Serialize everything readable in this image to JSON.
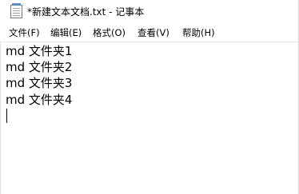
{
  "window": {
    "title": "*新建文本文档.txt - 记事本",
    "app_icon": "notepad-icon"
  },
  "menubar": {
    "file": "文件(F)",
    "edit": "编辑(E)",
    "format": "格式(O)",
    "view": "查看(V)",
    "help": "帮助(H)"
  },
  "editor": {
    "lines": [
      "md 文件夹1",
      "md 文件夹2",
      "md 文件夹3",
      "md 文件夹4"
    ]
  }
}
